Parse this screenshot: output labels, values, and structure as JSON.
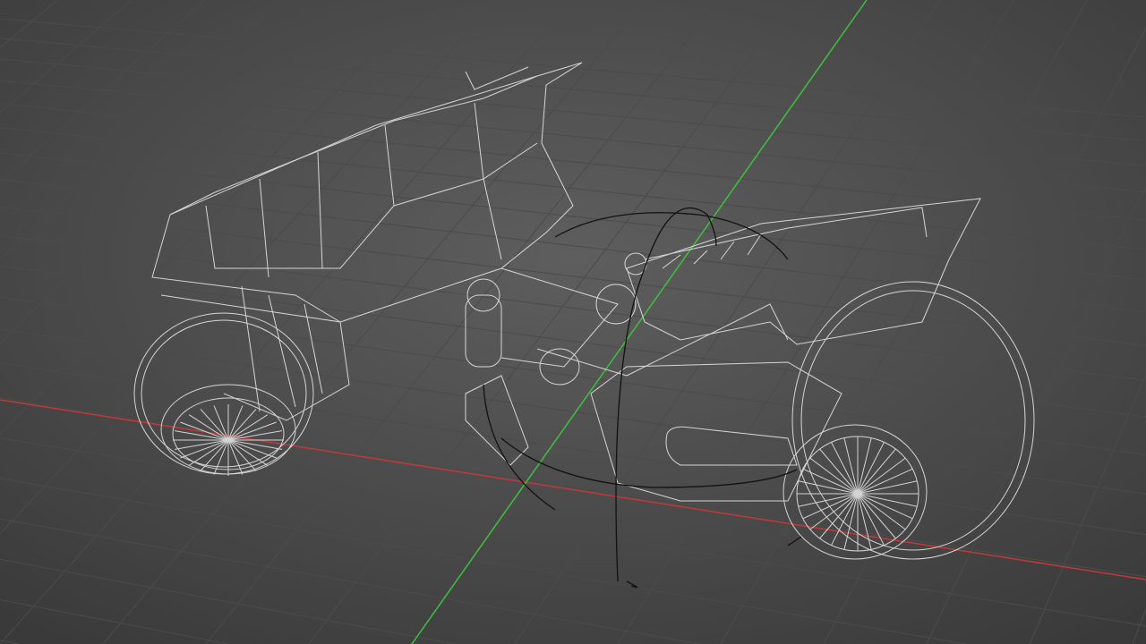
{
  "viewport": {
    "mode": "wireframe",
    "background_center": "#5c5c5c",
    "background_edge": "#3b3b3b",
    "grid_color": "#4a4a4a",
    "x_axis_color": "#c0393b",
    "y_axis_color": "#3fbf3f",
    "wire_color": "#e6e6e6",
    "annotation_color": "#111111"
  }
}
